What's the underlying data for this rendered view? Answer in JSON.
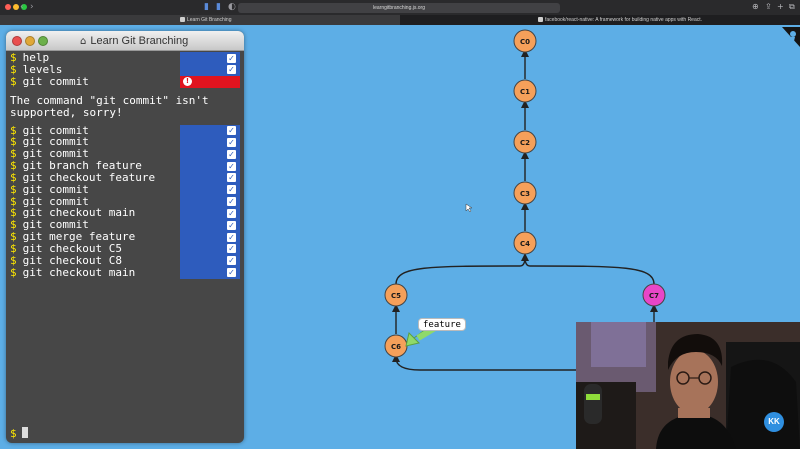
{
  "browser": {
    "url": "learngitbranching.js.org",
    "tabs": [
      {
        "label": "Learn Git Branching",
        "active": true
      },
      {
        "label": "facebook/react-native: A framework for building native apps with React.",
        "active": false
      }
    ]
  },
  "terminal": {
    "title": "Learn Git Branching",
    "prompt": "$",
    "history": [
      {
        "command": "help",
        "status": "ok"
      },
      {
        "command": "levels",
        "status": "ok"
      },
      {
        "command": "git commit",
        "status": "error"
      }
    ],
    "error_message": "The command \"git commit\" isn't\nsupported, sorry!",
    "commands": [
      {
        "command": "git commit",
        "status": "ok"
      },
      {
        "command": "git commit",
        "status": "ok"
      },
      {
        "command": "git commit",
        "status": "ok"
      },
      {
        "command": "git branch feature",
        "status": "ok"
      },
      {
        "command": "git checkout feature",
        "status": "ok"
      },
      {
        "command": "git commit",
        "status": "ok"
      },
      {
        "command": "git commit",
        "status": "ok"
      },
      {
        "command": "git checkout main",
        "status": "ok"
      },
      {
        "command": "git commit",
        "status": "ok"
      },
      {
        "command": "git merge feature",
        "status": "ok"
      },
      {
        "command": "git checkout C5",
        "status": "ok"
      },
      {
        "command": "git checkout C8",
        "status": "ok"
      },
      {
        "command": "git checkout main",
        "status": "ok"
      }
    ],
    "input_value": ""
  },
  "graph": {
    "commits": [
      "C0",
      "C1",
      "C2",
      "C3",
      "C4",
      "C5",
      "C6",
      "C7"
    ],
    "branch_label": "feature",
    "colors": {
      "background": "#5daee6",
      "commit": "#f5a05a",
      "head_commit": "#e846c8",
      "branch_tag": "#8fd96a"
    }
  },
  "overlay": {
    "badge": "KK"
  }
}
